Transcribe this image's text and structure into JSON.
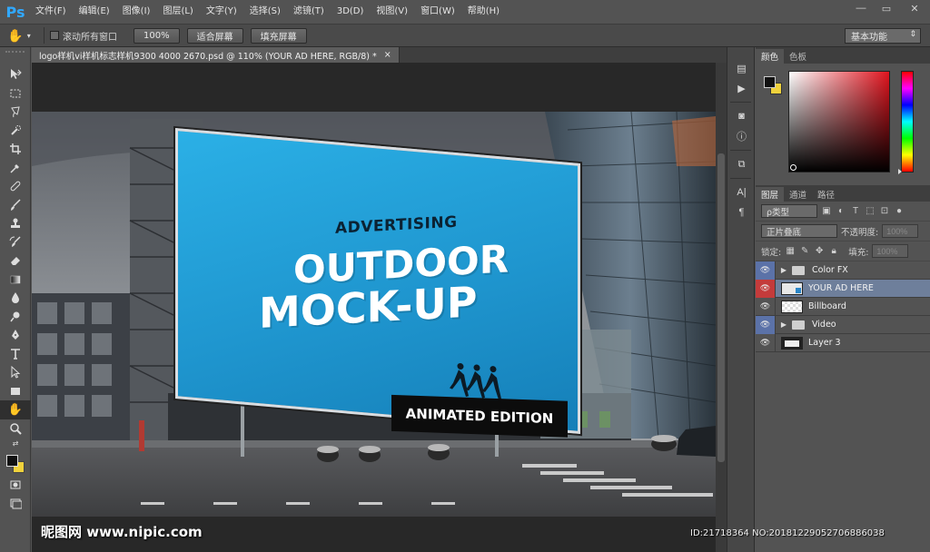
{
  "app": {
    "logo": "Ps",
    "menu": [
      "文件(F)",
      "编辑(E)",
      "图像(I)",
      "图层(L)",
      "文字(Y)",
      "选择(S)",
      "滤镜(T)",
      "3D(D)",
      "视图(V)",
      "窗口(W)",
      "帮助(H)"
    ],
    "window_controls": {
      "minimize": "—",
      "maximize": "▭",
      "close": "✕"
    }
  },
  "options": {
    "scroll_all_label": "滚动所有窗口",
    "zoom_100": "100%",
    "fit_screen": "适合屏幕",
    "fill_screen": "填充屏幕",
    "workspace": "基本功能"
  },
  "document": {
    "tab_title": "logo样机vi样机标志样机9300 4000 2670.psd @ 110% (YOUR AD HERE, RGB/8) *",
    "tab_close": "×"
  },
  "billboard": {
    "line1": "ADVERTISING",
    "line2": "OUTDOOR",
    "line3": "MOCK-UP",
    "banner": "ANIMATED EDITION"
  },
  "watermark": {
    "site": "昵图网 www.nipic.com",
    "id": "ID:21718364 NO:20181229052706886038"
  },
  "color_panel": {
    "tabs": [
      "颜色",
      "色板"
    ],
    "fg": "#111111",
    "bg": "#f0d23c"
  },
  "layers_panel": {
    "tabs": [
      "图层",
      "通道",
      "路径"
    ],
    "filter_kind": "ρ类型",
    "blend_mode": "正片叠底",
    "opacity_label": "不透明度:",
    "opacity_value": "100%",
    "lock_label": "锁定:",
    "fill_label": "填充:",
    "fill_value": "100%",
    "layers": [
      {
        "name": "Color FX",
        "type": "folder",
        "eye": "blue"
      },
      {
        "name": "YOUR AD HERE",
        "type": "smart",
        "eye": "red",
        "selected": true
      },
      {
        "name": "Billboard",
        "type": "pixel",
        "eye": "none"
      },
      {
        "name": "Video",
        "type": "folder",
        "eye": "blue"
      },
      {
        "name": "Layer 3",
        "type": "pixel",
        "eye": "none"
      }
    ]
  }
}
